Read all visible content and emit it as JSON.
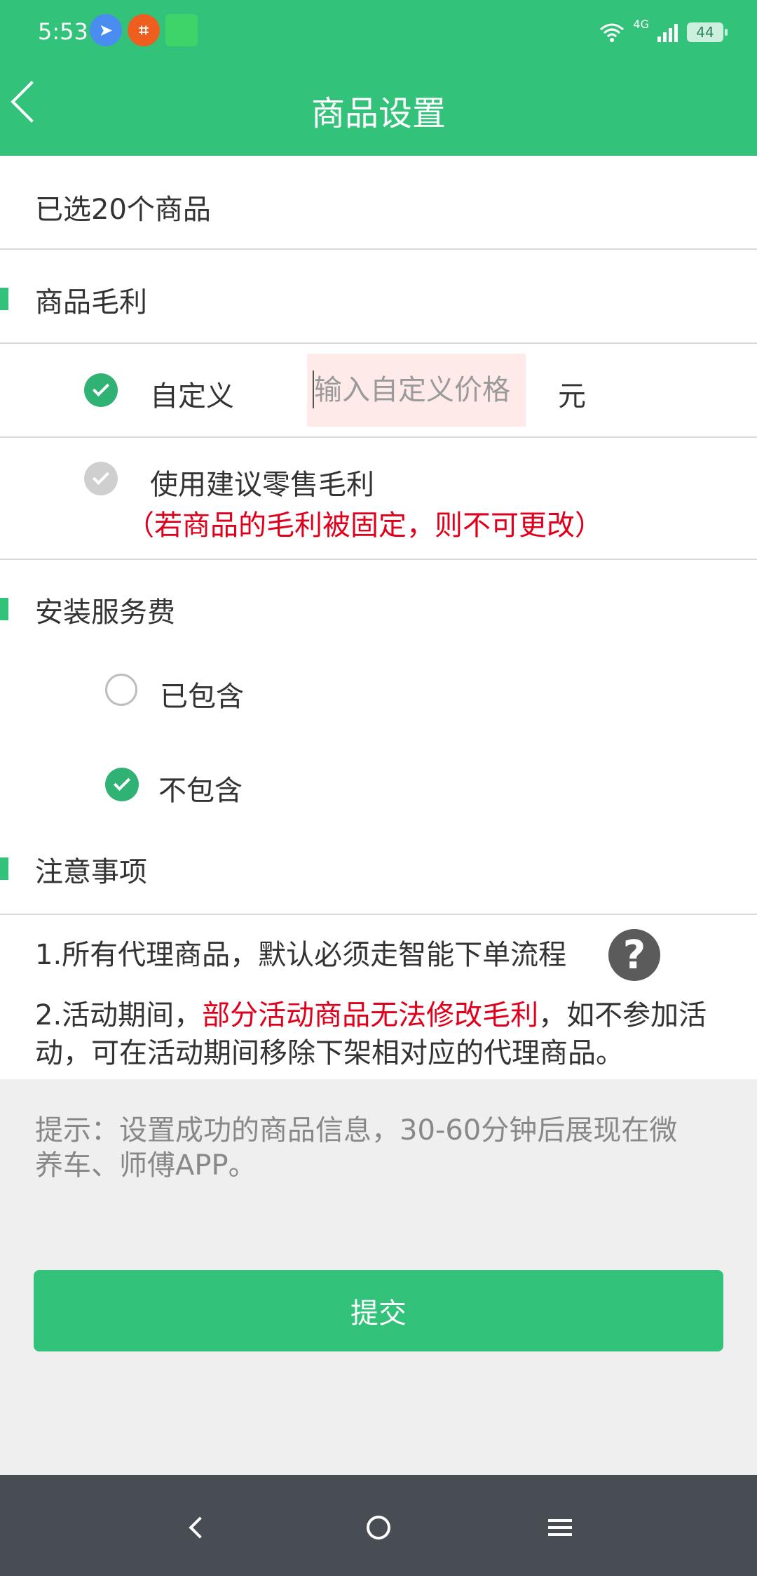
{
  "status_bar": {
    "time": "5:53",
    "app_icons": [
      "telegram-icon",
      "crop-icon",
      "app-icon"
    ],
    "network_label": "4G",
    "battery": "44"
  },
  "header": {
    "title": "商品设置",
    "back_icon": "chevron-left-icon"
  },
  "selection": {
    "text": "已选20个商品"
  },
  "profit_section": {
    "title": "商品毛利",
    "custom": {
      "label": "自定义",
      "checked": true,
      "input_placeholder": "输入自定义价格",
      "input_value": "",
      "unit": "元"
    },
    "suggested": {
      "label": "使用建议零售毛利",
      "checked": false,
      "note": "（若商品的毛利被固定，则不可更改）"
    }
  },
  "install_section": {
    "title": "安装服务费",
    "options": [
      {
        "label": "已包含",
        "checked": false
      },
      {
        "label": "不包含",
        "checked": true
      }
    ]
  },
  "notes_section": {
    "title": "注意事项",
    "note1": "1.所有代理商品，默认必须走智能下单流程",
    "note2_prefix": "2.活动期间，",
    "note2_highlight": "部分活动商品无法修改毛利",
    "note2_suffix_line1": "，如不参加活",
    "note2_line2": "动，可在活动期间移除下架相对应的代理商品。"
  },
  "tip": {
    "line1": "提示：设置成功的商品信息，30-60分钟后展现在微",
    "line2": "养车、师傅APP。"
  },
  "submit": {
    "label": "提交"
  },
  "colors": {
    "brand_green": "#33c27a",
    "warning_red": "#e0001b",
    "input_bg": "#ffeaea",
    "nav_bar": "#474d53"
  }
}
